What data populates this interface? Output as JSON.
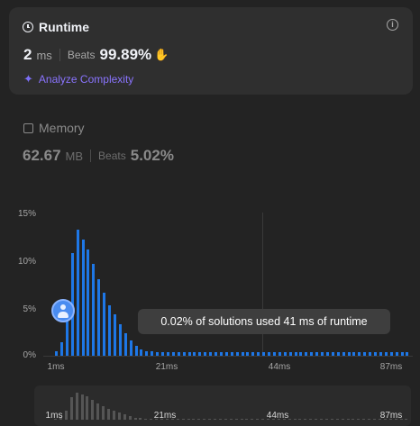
{
  "runtime": {
    "title": "Runtime",
    "value": "2",
    "unit": "ms",
    "beats_label": "Beats",
    "beats_value": "99.89%",
    "analyze_label": "Analyze Complexity"
  },
  "memory": {
    "title": "Memory",
    "value": "62.67",
    "unit": "MB",
    "beats_label": "Beats",
    "beats_value": "5.02%"
  },
  "chart_data": {
    "type": "bar",
    "y_ticks": [
      "15%",
      "10%",
      "5%",
      "0%"
    ],
    "x_ticks": [
      "1ms",
      "21ms",
      "44ms",
      "87ms"
    ],
    "ylim": [
      0,
      15
    ],
    "values": [
      0.5,
      1.4,
      4.2,
      10.8,
      13.2,
      12.2,
      11.1,
      9.6,
      8.0,
      6.6,
      5.3,
      4.3,
      3.3,
      2.4,
      1.6,
      1.0,
      0.7,
      0.5,
      0.45,
      0.4,
      0.4,
      0.4,
      0.4,
      0.4,
      0.4,
      0.4,
      0.4,
      0.4,
      0.4,
      0.4,
      0.4,
      0.4,
      0.4,
      0.4,
      0.4,
      0.4,
      0.4,
      0.4,
      0.4,
      0.4,
      0.4,
      0.4,
      0.4,
      0.4,
      0.4,
      0.4,
      0.4,
      0.4,
      0.4,
      0.4,
      0.4,
      0.4,
      0.4,
      0.4,
      0.4,
      0.4,
      0.4,
      0.4,
      0.4,
      0.4,
      0.4,
      0.4,
      0.4,
      0.4,
      0.4,
      0.4,
      0.4
    ],
    "tooltip": "0.02% of solutions used 41 ms of runtime",
    "accent_color": "#1e77e6"
  },
  "mini_chart": {
    "x_ticks": [
      "1ms",
      "21ms",
      "44ms",
      "87ms"
    ]
  }
}
